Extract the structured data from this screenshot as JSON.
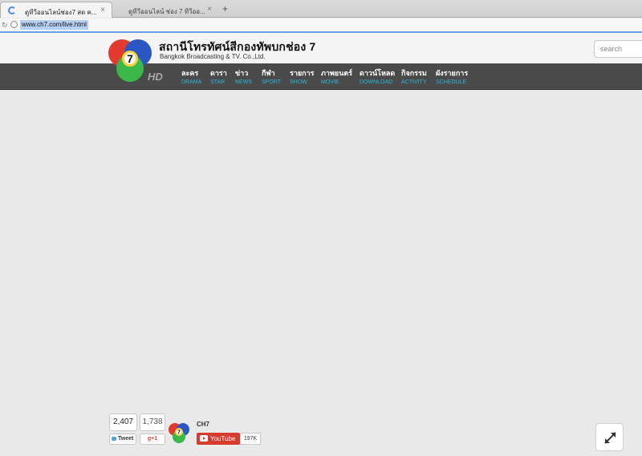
{
  "browser": {
    "tabs": [
      {
        "title": "ดูทีวีออนไลน์ช่อง7 สด ค...",
        "active": true
      },
      {
        "title": "ดูทีวีออนไลน์ ช่อง 7 ทีวีออ...",
        "active": false
      }
    ],
    "close_glyph": "×",
    "new_tab_glyph": "+",
    "url": "www.ch7.com/live.html"
  },
  "site": {
    "title": "สถานีโทรทัศน์สีกองทัพบกช่อง 7",
    "subtitle": "Bangkok Broadcasting & TV. Co.,Ltd.",
    "logo_number": "7",
    "hd_label": "HD",
    "search_placeholder": "search"
  },
  "nav": [
    {
      "th": "ละคร",
      "en": "DRAMA"
    },
    {
      "th": "ดารา",
      "en": "STAR"
    },
    {
      "th": "ข่าว",
      "en": "NEWS"
    },
    {
      "th": "กีฬา",
      "en": "SPORT"
    },
    {
      "th": "รายการ",
      "en": "SHOW"
    },
    {
      "th": "ภาพยนตร์",
      "en": "MOVIE"
    },
    {
      "th": "ดาวน์โหลด",
      "en": "DOWNLOAD"
    },
    {
      "th": "กิจกรรม",
      "en": "ACTIVITY"
    },
    {
      "th": "ผังรายการ",
      "en": "SCHEDULE"
    }
  ],
  "social": {
    "tweet_count": "2,407",
    "tweet_label": "Tweet",
    "gplus_count": "1,738",
    "gplus_label": "g+1",
    "youtube_channel": "CH7",
    "youtube_label": "YouTube",
    "youtube_subscribers": "197K"
  },
  "colors": {
    "nav_bg": "#4a4a4a",
    "nav_en_text": "#2bb8d8",
    "youtube_red": "#d63b2e",
    "url_highlight": "#b5d0f2"
  }
}
